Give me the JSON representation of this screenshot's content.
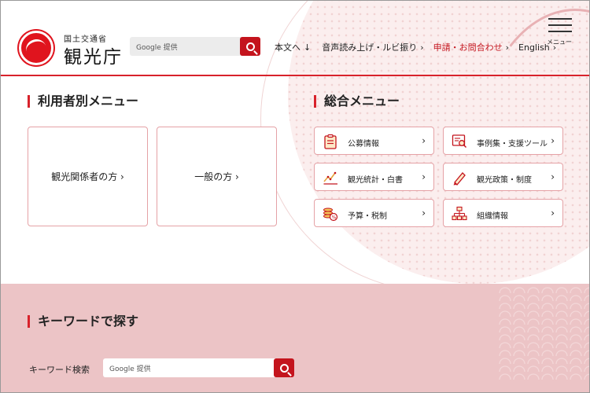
{
  "header": {
    "ministry": "国土交通省",
    "agency": "観光庁",
    "search_placeholder": "Google 提供",
    "nav": [
      {
        "label": "本文へ",
        "arrow": "↓"
      },
      {
        "label": "音声読み上げ・ルビ振り",
        "arrow": "›"
      },
      {
        "label": "申請・お問合わせ",
        "arrow": "›"
      },
      {
        "label": "English",
        "arrow": "›"
      }
    ],
    "menu_label": "メニュー"
  },
  "user_menu": {
    "title": "利用者別メニュー",
    "cards": [
      "観光関係者の方 ›",
      "一般の方 ›"
    ]
  },
  "general_menu": {
    "title": "総合メニュー",
    "items": [
      {
        "label": "公募情報",
        "icon": "clipboard-icon"
      },
      {
        "label": "事例集・支援ツール",
        "icon": "document-search-icon"
      },
      {
        "label": "観光統計・白書",
        "icon": "line-chart-icon"
      },
      {
        "label": "観光政策・制度",
        "icon": "pencil-icon"
      },
      {
        "label": "予算・税制",
        "icon": "coins-icon"
      },
      {
        "label": "組織情報",
        "icon": "org-chart-icon"
      }
    ],
    "chevron": "›"
  },
  "keyword": {
    "title": "キーワードで探す",
    "label": "キーワード検索",
    "placeholder": "Google 提供"
  },
  "colors": {
    "accent": "#c4141d",
    "card_border": "#e5a2a6",
    "band": "#ecc4c6"
  }
}
